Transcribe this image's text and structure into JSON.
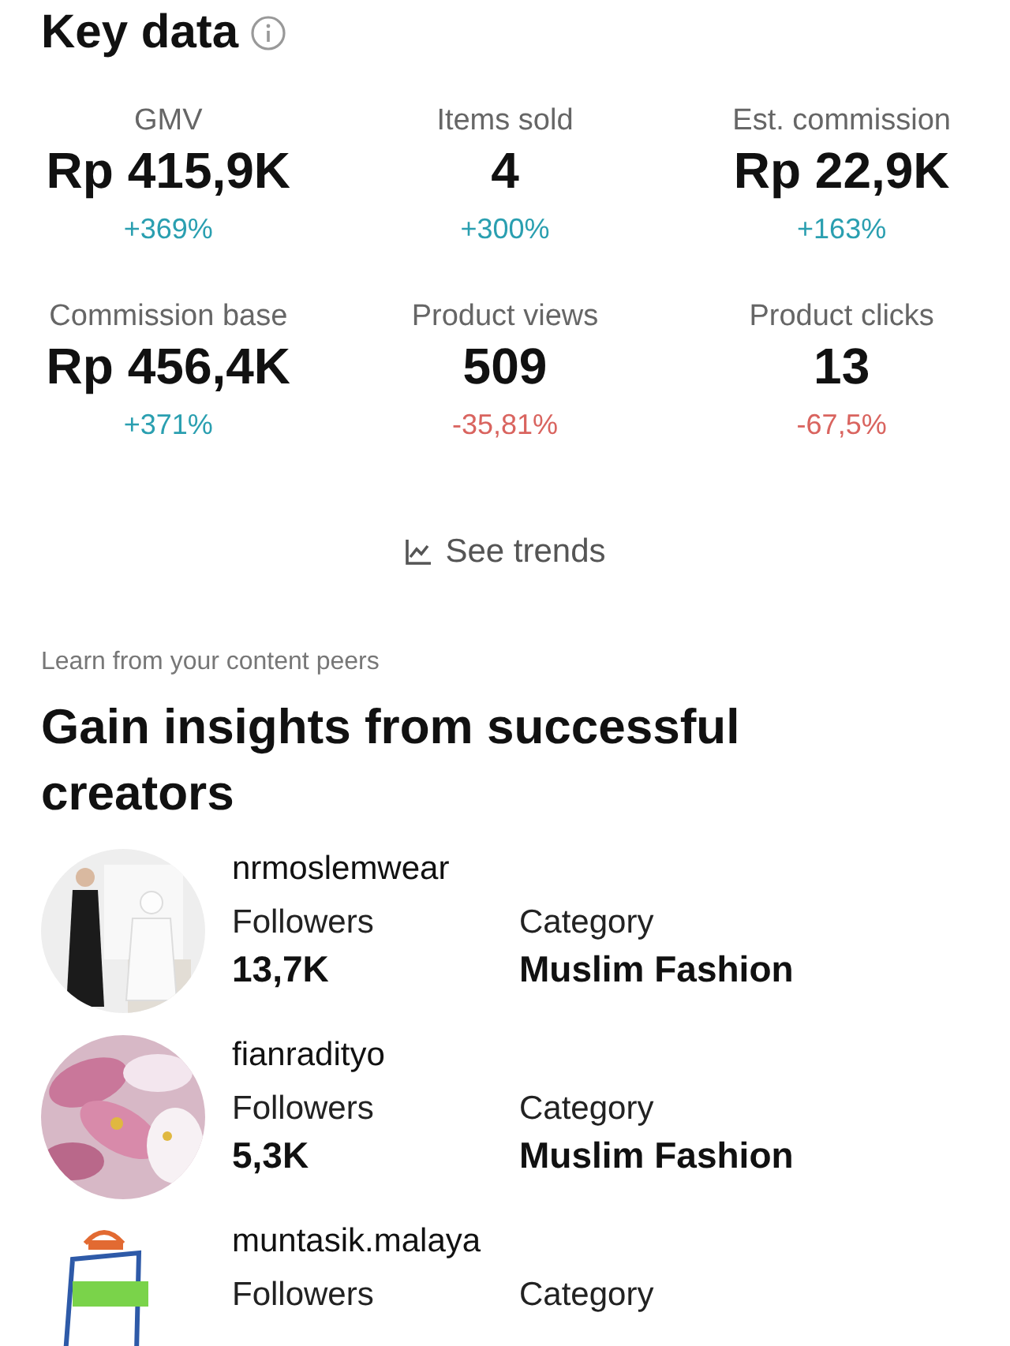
{
  "key_data": {
    "title": "Key data",
    "metrics": [
      {
        "label": "GMV",
        "value": "Rp 415,9K",
        "change": "+369%",
        "color": "#2a9fb0"
      },
      {
        "label": "Items sold",
        "value": "4",
        "change": "+300%",
        "color": "#2a9fb0"
      },
      {
        "label": "Est. commission",
        "value": "Rp 22,9K",
        "change": "+163%",
        "color": "#2a9fb0"
      },
      {
        "label": "Commission base",
        "value": "Rp 456,4K",
        "change": "+371%",
        "color": "#2a9fb0"
      },
      {
        "label": "Product views",
        "value": "509",
        "change": "-35,81%",
        "color": "#d9645f"
      },
      {
        "label": "Product clicks",
        "value": "13",
        "change": "-67,5%",
        "color": "#d9645f"
      }
    ],
    "link": "See trends"
  },
  "peers": {
    "subtitle": "Learn from your content peers",
    "title": "Gain insights from successful creators",
    "creators": [
      {
        "name": "nrmoslemwear",
        "followers_label": "Followers",
        "followers": "13,7K",
        "category_label": "Category",
        "category": "Muslim Fashion"
      },
      {
        "name": "fianradityo",
        "followers_label": "Followers",
        "followers": "5,3K",
        "category_label": "Category",
        "category": "Muslim Fashion"
      },
      {
        "name": "muntasik.malaya",
        "followers_label": "Followers",
        "category_label": "Category"
      }
    ]
  }
}
